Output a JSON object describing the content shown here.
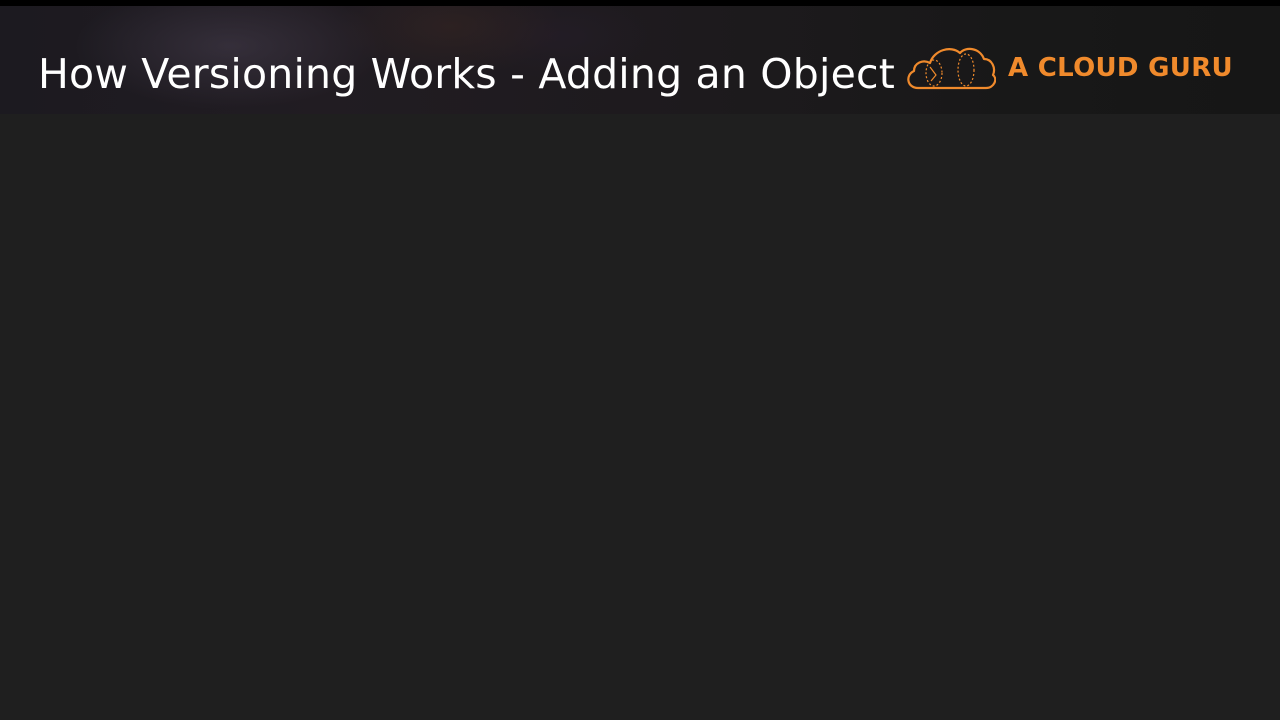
{
  "slide": {
    "title": "How Versioning Works - Adding an Object"
  },
  "brand": {
    "name": "A CLOUD GURU",
    "logo_icon": "cloud-logo-icon",
    "color": "#f08a2c"
  },
  "colors": {
    "background": "#1f1f1f",
    "title_text": "#ffffff"
  }
}
